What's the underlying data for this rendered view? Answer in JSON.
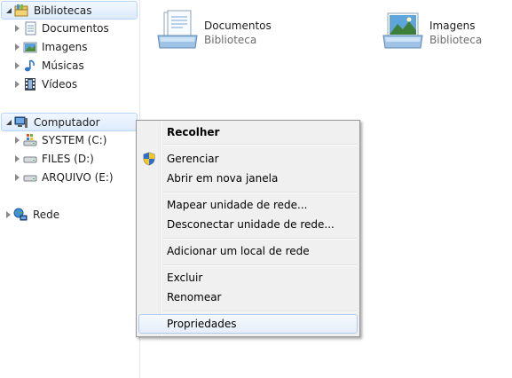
{
  "navigation": {
    "libraries": {
      "label": "Bibliotecas",
      "children": [
        "Documentos",
        "Imagens",
        "Músicas",
        "Vídeos"
      ]
    },
    "computer": {
      "label": "Computador",
      "drives": [
        "SYSTEM (C:)",
        "FILES (D:)",
        "ARQUIVO (E:)"
      ]
    },
    "network": {
      "label": "Rede"
    }
  },
  "content": {
    "items": [
      {
        "name": "Documentos",
        "type": "Biblioteca",
        "icon": "documents-library-icon"
      },
      {
        "name": "Imagens",
        "type": "Biblioteca",
        "icon": "pictures-library-icon"
      }
    ]
  },
  "context_menu": {
    "collapse": "Recolher",
    "manage": "Gerenciar",
    "open_new_window": "Abrir em nova janela",
    "map_drive": "Mapear unidade de rede...",
    "disconnect_drive": "Desconectar unidade de rede...",
    "add_network_location": "Adicionar um local de rede",
    "delete": "Excluir",
    "rename": "Renomear",
    "properties": "Propriedades"
  },
  "colors": {
    "selection_border": "#b8d6fb",
    "hover_border": "#aeccf0",
    "menu_background": "#f0f0f0"
  }
}
